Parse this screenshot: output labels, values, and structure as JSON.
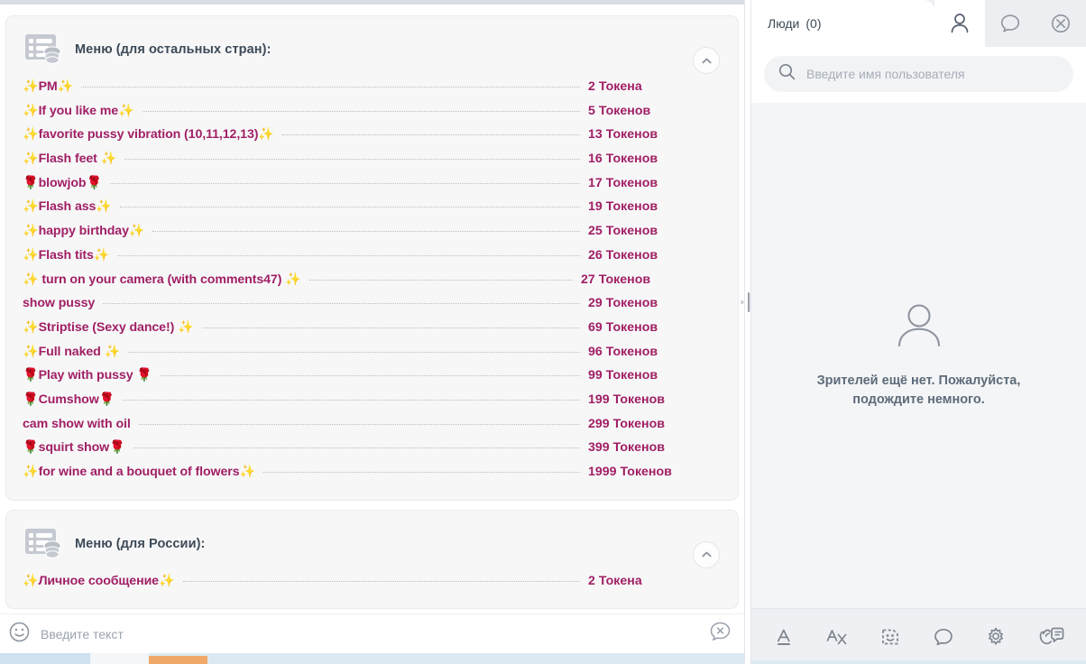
{
  "left_pane": {
    "sections": [
      {
        "icon": "menu-coins-icon",
        "title": "Меню (для остальных стран):",
        "collapse_icon": "chevron-up-icon",
        "rows": [
          {
            "label": "✨PM✨",
            "price": "2 Токена"
          },
          {
            "label": "✨If you like me✨",
            "price": "5 Токенов"
          },
          {
            "label": "✨favorite pussy vibration (10,11,12,13)✨",
            "price": "13 Токенов"
          },
          {
            "label": "✨Flash feet ✨",
            "price": "16 Токенов"
          },
          {
            "label": "🌹blowjob🌹",
            "price": "17 Токенов"
          },
          {
            "label": "✨Flash ass✨",
            "price": "19 Токенов"
          },
          {
            "label": "✨happy birthday✨",
            "price": "25 Токенов"
          },
          {
            "label": "✨Flash tits✨",
            "price": "26 Токенов"
          },
          {
            "label": "✨ turn on your camera (with  comments47) ✨",
            "price": "27 Токенов"
          },
          {
            "label": "show pussy",
            "price": "29 Токенов"
          },
          {
            "label": "✨Striptise (Sexy dance!) ✨",
            "price": "69 Токенов"
          },
          {
            "label": "✨Full naked ✨",
            "price": "96 Токенов"
          },
          {
            "label": "🌹Play with pussy 🌹",
            "price": "99 Токенов"
          },
          {
            "label": "🌹Cumshow🌹",
            "price": "199 Токенов"
          },
          {
            "label": "cam show with oil",
            "price": "299 Токенов"
          },
          {
            "label": "🌹squirt show🌹",
            "price": "399 Токенов"
          },
          {
            "label": "✨for wine and a bouquet of flowers✨",
            "price": "1999 Токенов"
          }
        ]
      },
      {
        "icon": "menu-coins-icon",
        "title": "Меню (для России):",
        "collapse_icon": "chevron-up-icon",
        "rows": [
          {
            "label": "✨Личное сообщение✨",
            "price": "2 Токена"
          }
        ]
      }
    ],
    "composer": {
      "emoji_icon": "smiley-icon",
      "placeholder": "Введите текст",
      "value": "",
      "right_icon": "chat-dismiss-icon"
    }
  },
  "right_pane": {
    "tabs": {
      "active_label": "Люди",
      "active_count": "(0)",
      "icons": [
        {
          "name": "people-tab-icon",
          "active": true
        },
        {
          "name": "chat-tab-icon",
          "active": false
        },
        {
          "name": "close-circle-icon",
          "active": false
        }
      ]
    },
    "search": {
      "icon": "search-icon",
      "placeholder": "Введите имя пользователя",
      "value": ""
    },
    "empty_state": {
      "icon": "person-icon",
      "message": "Зрителей ещё нет. Пожалуйста, подождите немного."
    },
    "toolbar": [
      {
        "name": "text-color-icon"
      },
      {
        "name": "translate-icon"
      },
      {
        "name": "sticker-icon"
      },
      {
        "name": "chat-bubble-icon"
      },
      {
        "name": "gear-icon"
      },
      {
        "name": "sign-language-icon"
      }
    ]
  },
  "colors": {
    "menu_text": "#a01f64",
    "menu_title": "#3c4a57",
    "panel_bg": "#f4f5f7",
    "accent_orange": "#f0a868",
    "strip_blue": "#dce9f2"
  }
}
